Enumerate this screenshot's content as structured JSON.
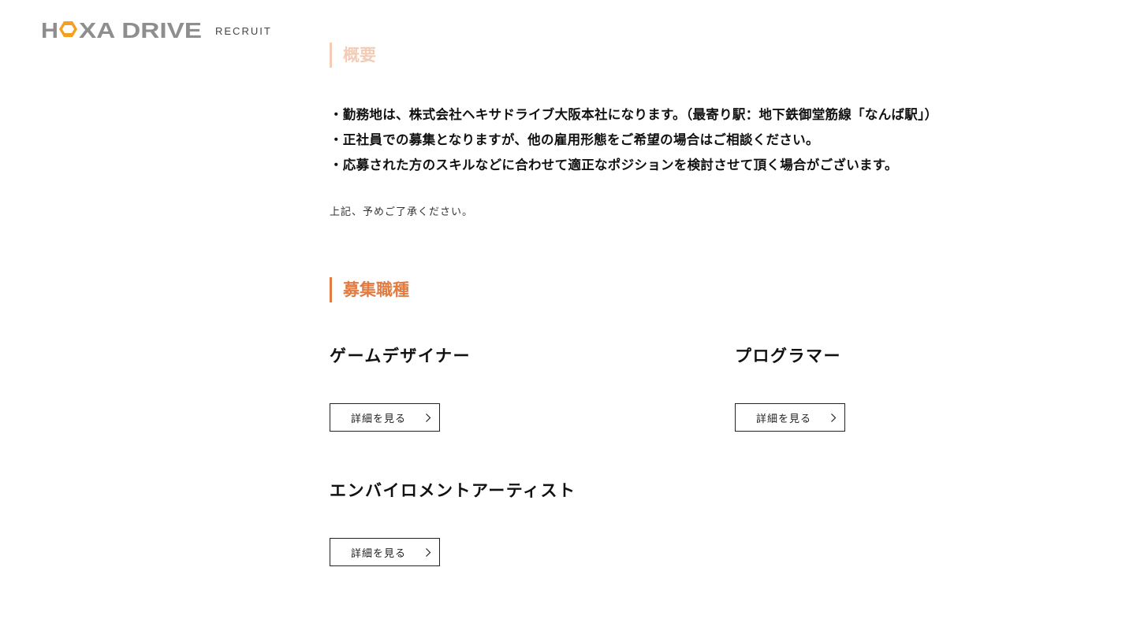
{
  "header": {
    "logo_text": "HEXA DRIVE",
    "logo_sub": "RECRUIT",
    "colors": {
      "logo_gray": "#8e8e8e",
      "logo_orange": "#f4a020"
    }
  },
  "overview": {
    "heading": "概要",
    "notes": [
      "・勤務地は、株式会社ヘキサドライブ大阪本社になります。（最寄り駅：地下鉄御堂筋線「なんば駅」）",
      "・正社員での募集となりますが、他の雇用形態をご希望の場合はご相談ください。",
      "・応募された方のスキルなどに合わせて適正なポジションを検討させて頂く場合がございます。"
    ],
    "caption": "上記、予めご了承ください。"
  },
  "positions": {
    "heading": "募集職種",
    "items": [
      {
        "title": "ゲームデザイナー",
        "button_label": "詳細を見る"
      },
      {
        "title": "プログラマー",
        "button_label": "詳細を見る"
      },
      {
        "title": "エンバイロメントアーティスト",
        "button_label": "詳細を見る"
      }
    ]
  },
  "accent_color": "#e17b42",
  "icons": {
    "button_icon": "chevron-right-icon"
  }
}
